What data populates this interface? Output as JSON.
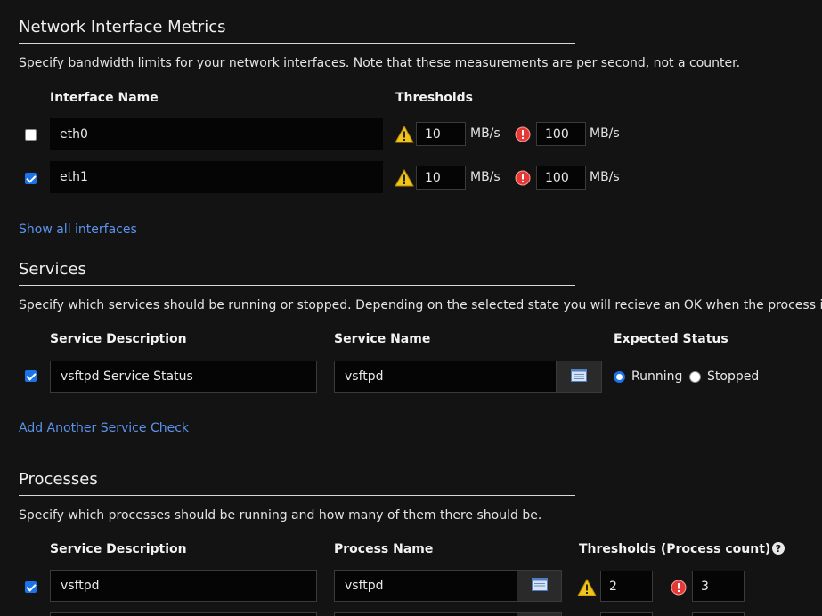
{
  "network": {
    "title": "Network Interface Metrics",
    "description": "Specify bandwidth limits for your network interfaces. Note that these measurements are per second, not a counter.",
    "col_interface": "Interface Name",
    "col_thresholds": "Thresholds",
    "rows": [
      {
        "checked": false,
        "name": "eth0",
        "warn": "10",
        "warn_unit": "MB/s",
        "crit": "100",
        "crit_unit": "MB/s"
      },
      {
        "checked": true,
        "name": "eth1",
        "warn": "10",
        "warn_unit": "MB/s",
        "crit": "100",
        "crit_unit": "MB/s"
      }
    ],
    "show_all_link": "Show all interfaces"
  },
  "services": {
    "title": "Services",
    "description": "Specify which services should be running or stopped. Depending on the selected state you will recieve an OK when the process is",
    "col_description": "Service Description",
    "col_name": "Service Name",
    "col_status": "Expected Status",
    "rows": [
      {
        "checked": true,
        "description": "vsftpd Service Status",
        "name": "vsftpd",
        "running_label": "Running",
        "stopped_label": "Stopped",
        "selected": "Running"
      }
    ],
    "add_link": "Add Another Service Check"
  },
  "processes": {
    "title": "Processes",
    "description": "Specify which processes should be running and how many of them there should be.",
    "col_description": "Service Description",
    "col_name": "Process Name",
    "col_thresholds": "Thresholds (Process count)",
    "help_glyph": "?",
    "rows": [
      {
        "checked": true,
        "description": "vsftpd",
        "name": "vsftpd",
        "warn": "2",
        "crit": "3"
      }
    ]
  },
  "colors": {
    "accent": "#1a73e8",
    "link": "#5c93ee",
    "warning": "#f0c419",
    "critical": "#e53935",
    "background": "#131313"
  },
  "icons": {
    "warning": "warning-triangle-icon",
    "critical": "critical-circle-icon",
    "picker": "list-picker-icon",
    "help": "help-circle-icon"
  }
}
